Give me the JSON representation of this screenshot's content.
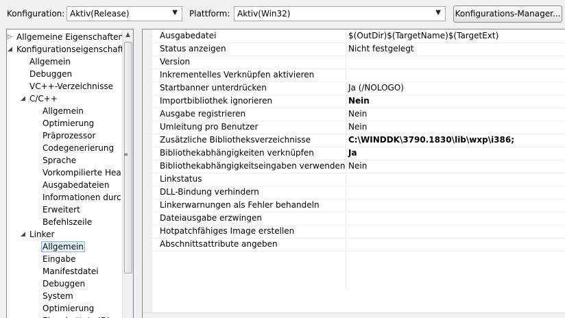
{
  "toolbar": {
    "config_label": "Konfiguration:",
    "config_value": "Aktiv(Release)",
    "platform_label": "Plattform:",
    "platform_value": "Aktiv(Win32)",
    "manager_button": "Konfigurations-Manager..."
  },
  "tree": [
    {
      "label": "Allgemeine Eigenschaften",
      "level": 0,
      "twisty": "closed"
    },
    {
      "label": "Konfigurationseigenschaften",
      "level": 0,
      "twisty": "open"
    },
    {
      "label": "Allgemein",
      "level": 1
    },
    {
      "label": "Debuggen",
      "level": 1
    },
    {
      "label": "VC++-Verzeichnisse",
      "level": 1
    },
    {
      "label": "C/C++",
      "level": 1,
      "twisty": "open"
    },
    {
      "label": "Allgemein",
      "level": 2
    },
    {
      "label": "Optimierung",
      "level": 2
    },
    {
      "label": "Präprozessor",
      "level": 2
    },
    {
      "label": "Codegenerierung",
      "level": 2
    },
    {
      "label": "Sprache",
      "level": 2
    },
    {
      "label": "Vorkompilierte Hea",
      "level": 2
    },
    {
      "label": "Ausgabedateien",
      "level": 2
    },
    {
      "label": "Informationen durc",
      "level": 2
    },
    {
      "label": "Erweitert",
      "level": 2
    },
    {
      "label": "Befehlszeile",
      "level": 2
    },
    {
      "label": "Linker",
      "level": 1,
      "twisty": "open"
    },
    {
      "label": "Allgemein",
      "level": 2,
      "selected": true
    },
    {
      "label": "Eingabe",
      "level": 2
    },
    {
      "label": "Manifestdatei",
      "level": 2
    },
    {
      "label": "Debuggen",
      "level": 2
    },
    {
      "label": "System",
      "level": 2
    },
    {
      "label": "Optimierung",
      "level": 2
    },
    {
      "label": "Eingebettete IDL",
      "level": 2
    }
  ],
  "properties": [
    {
      "name": "Ausgabedatei",
      "value": "$(OutDir)$(TargetName)$(TargetExt)"
    },
    {
      "name": "Status anzeigen",
      "value": "Nicht festgelegt"
    },
    {
      "name": "Version",
      "value": ""
    },
    {
      "name": "Inkrementelles Verknüpfen aktivieren",
      "value": ""
    },
    {
      "name": "Startbanner unterdrücken",
      "value": "Ja (/NOLOGO)"
    },
    {
      "name": "Importbibliothek ignorieren",
      "value": "Nein",
      "bold": true
    },
    {
      "name": "Ausgabe registrieren",
      "value": "Nein"
    },
    {
      "name": "Umleitung pro Benutzer",
      "value": "Nein"
    },
    {
      "name": "Zusätzliche Bibliotheksverzeichnisse",
      "value": "C:\\WINDDK\\3790.1830\\lib\\wxp\\i386;",
      "bold": true
    },
    {
      "name": "Bibliothekabhängigkeiten verknüpfen",
      "value": "Ja",
      "bold": true
    },
    {
      "name": "Bibliothekabhängigkeitseingaben verwenden",
      "value": "Nein"
    },
    {
      "name": "Linkstatus",
      "value": ""
    },
    {
      "name": "DLL-Bindung verhindern",
      "value": ""
    },
    {
      "name": "Linkerwarnungen als Fehler behandeln",
      "value": ""
    },
    {
      "name": "Dateiausgabe erzwingen",
      "value": ""
    },
    {
      "name": "Hotpatchfähiges Image erstellen",
      "value": ""
    },
    {
      "name": "Abschnittsattribute angeben",
      "value": ""
    }
  ]
}
